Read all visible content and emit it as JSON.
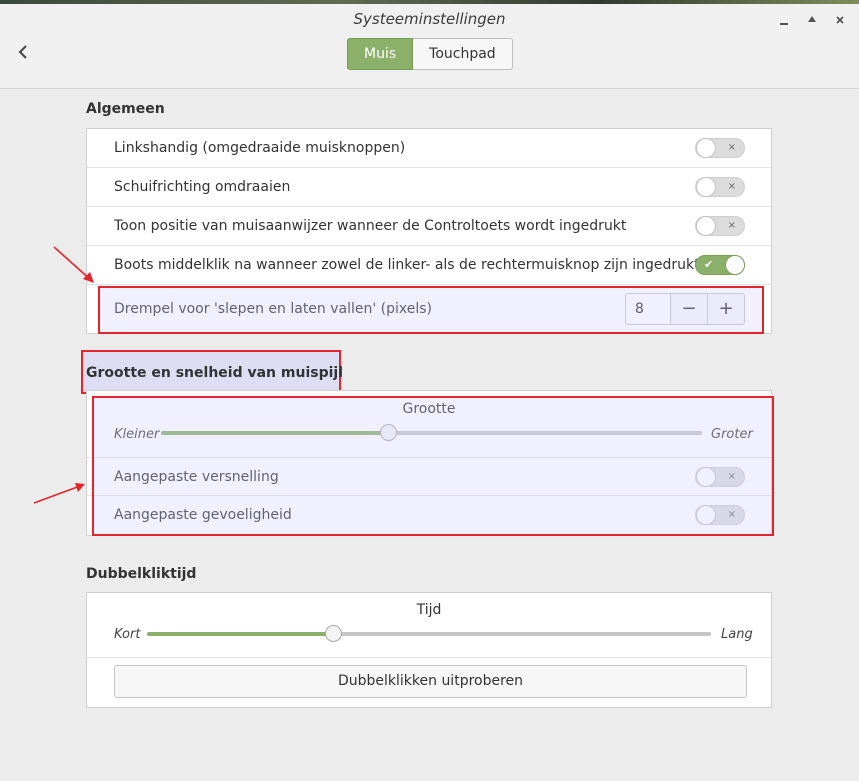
{
  "window": {
    "title": "Systeeminstellingen",
    "back_icon": "chevron-left-icon"
  },
  "switcher": {
    "tab_muis": "Muis",
    "tab_touchpad": "Touchpad",
    "active": "Muis"
  },
  "algemeen": {
    "heading": "Algemeen",
    "rows": [
      {
        "label": "Linkshandig (omgedraaide muisknoppen)",
        "on": false
      },
      {
        "label": "Schuifrichting omdraaien",
        "on": false
      },
      {
        "label": "Toon positie van muisaanwijzer wanneer de Controltoets wordt ingedrukt",
        "on": false
      },
      {
        "label": "Boots middelklik na wanneer zowel de linker- als de rechtermuisknop zijn ingedrukt",
        "on": true
      }
    ],
    "drag_threshold": {
      "label": "Drempel voor 'slepen en laten vallen' (pixels)",
      "value": "8",
      "minus": "−",
      "plus": "+"
    }
  },
  "pointer": {
    "heading": "Grootte en snelheid van muispijl",
    "size_slider": {
      "title": "Grootte",
      "min_label": "Kleiner",
      "max_label": "Groter",
      "fraction": 0.42
    },
    "rows": [
      {
        "label": "Aangepaste versnelling",
        "on": false
      },
      {
        "label": "Aangepaste gevoeligheid",
        "on": false
      }
    ]
  },
  "doubleclick": {
    "heading": "Dubbelkliktijd",
    "time_slider": {
      "title": "Tijd",
      "min_label": "Kort",
      "max_label": "Lang",
      "fraction": 0.33
    },
    "test_button": "Dubbelklikken uitproberen"
  },
  "toggle_marks": {
    "off": "×",
    "on": "✔"
  },
  "colors": {
    "accent": "#8ab06a",
    "annotation": "#e3262b"
  }
}
